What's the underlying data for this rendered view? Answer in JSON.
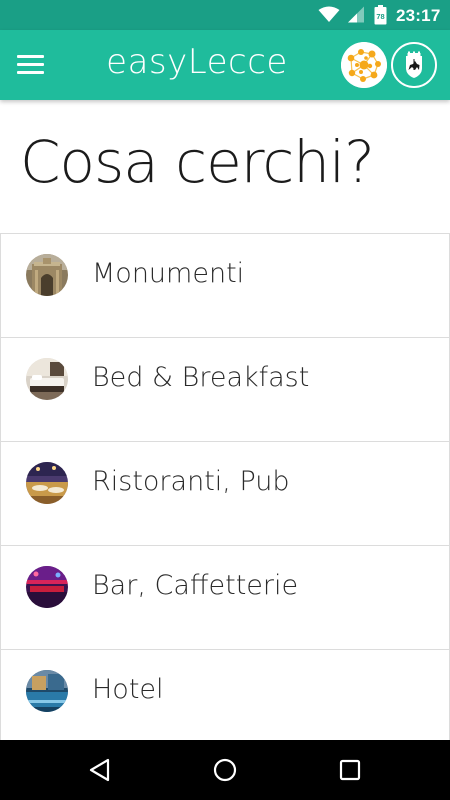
{
  "status_bar": {
    "time": "23:17",
    "battery_level": "78",
    "icons": [
      "wifi-icon",
      "cellular-signal-icon",
      "battery-icon"
    ]
  },
  "app_bar": {
    "title": "easyLecce",
    "menu_icon": "hamburger-menu-icon",
    "logos": [
      "easylecce-logo",
      "lecce-city-crest"
    ]
  },
  "page": {
    "heading": "Cosa cerchi?"
  },
  "categories": [
    {
      "label": "Monumenti",
      "icon": "monumenti-thumbnail"
    },
    {
      "label": "Bed & Breakfast",
      "icon": "bed-breakfast-thumbnail"
    },
    {
      "label": "Ristoranti, Pub",
      "icon": "ristoranti-pub-thumbnail"
    },
    {
      "label": "Bar, Caffetterie",
      "icon": "bar-caffetterie-thumbnail"
    },
    {
      "label": "Hotel",
      "icon": "hotel-thumbnail"
    }
  ],
  "nav_bar": {
    "buttons": [
      "back-icon",
      "home-icon",
      "recents-icon"
    ]
  },
  "colors": {
    "status_bar": "#1a9f86",
    "app_bar": "#1fbc9c",
    "text_primary": "#1b1b1b",
    "divider": "#dcdcdc",
    "nav_bar": "#000000"
  }
}
